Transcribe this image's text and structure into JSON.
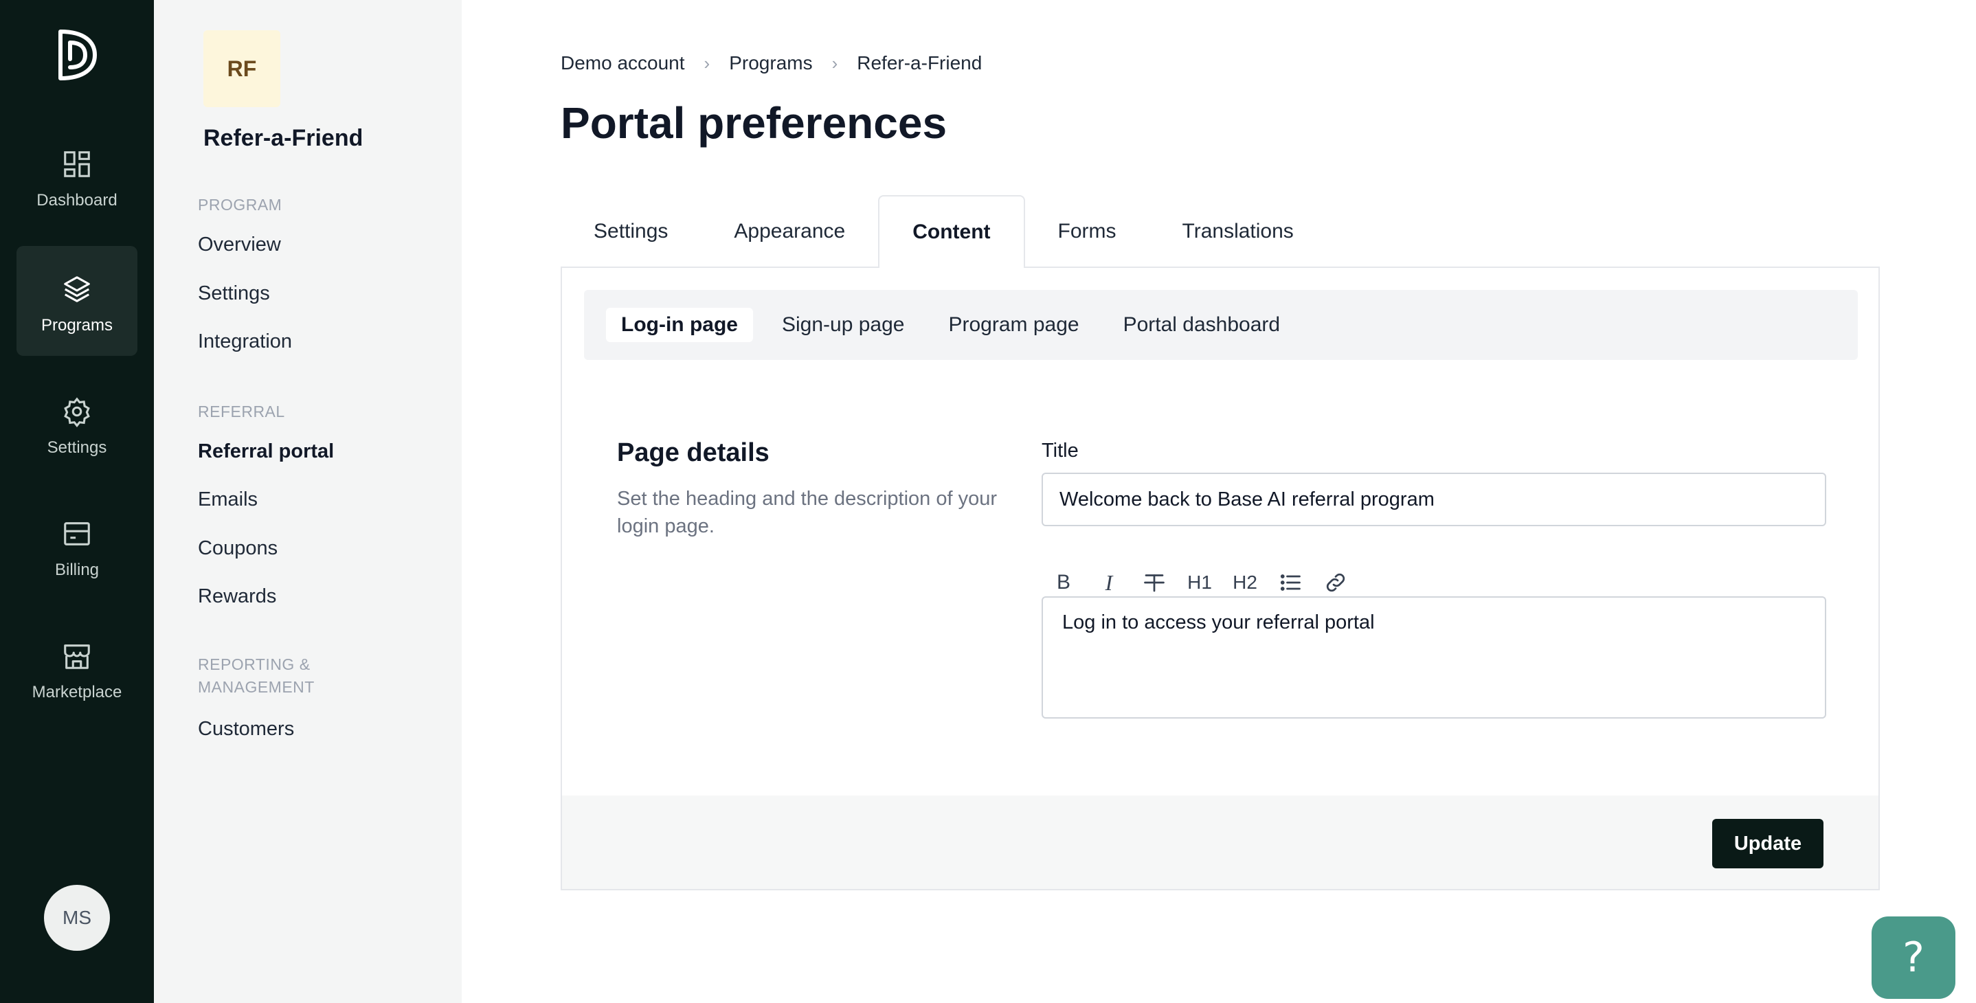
{
  "rail": {
    "items": [
      {
        "label": "Dashboard",
        "icon": "dashboard-icon"
      },
      {
        "label": "Programs",
        "icon": "layers-icon",
        "active": true
      },
      {
        "label": "Settings",
        "icon": "gear-icon"
      },
      {
        "label": "Billing",
        "icon": "billing-icon"
      },
      {
        "label": "Marketplace",
        "icon": "store-icon"
      }
    ],
    "avatar": "MS"
  },
  "subnav": {
    "badge": "RF",
    "program_name": "Refer-a-Friend",
    "sections": [
      {
        "heading": "PROGRAM",
        "items": [
          "Overview",
          "Settings",
          "Integration"
        ]
      },
      {
        "heading": "REFERRAL",
        "items": [
          "Referral portal",
          "Emails",
          "Coupons",
          "Rewards"
        ]
      },
      {
        "heading_lines": [
          "REPORTING &",
          "MANAGEMENT"
        ],
        "items": [
          "Customers"
        ]
      }
    ],
    "current": "Referral portal"
  },
  "breadcrumb": [
    "Demo account",
    "Programs",
    "Refer-a-Friend"
  ],
  "page_title": "Portal preferences",
  "tabs": [
    "Settings",
    "Appearance",
    "Content",
    "Forms",
    "Translations"
  ],
  "active_tab": "Content",
  "subtabs": [
    "Log-in page",
    "Sign-up page",
    "Program page",
    "Portal dashboard"
  ],
  "active_subtab": "Log-in page",
  "section": {
    "title": "Page details",
    "description": "Set the heading and the description of your login page."
  },
  "form": {
    "title_label": "Title",
    "title_value": "Welcome back to Base AI referral program",
    "toolbar": [
      "bold",
      "italic",
      "strikethrough",
      "heading-1",
      "heading-2",
      "bullet-list",
      "link"
    ],
    "toolbar_glyphs": {
      "bold": "B",
      "italic": "I",
      "h1": "H1",
      "h2": "H2"
    },
    "body_value": "Log in to access your referral portal"
  },
  "update_label": "Update",
  "help_label": "?",
  "colors": {
    "rail_bg": "#0a1a17",
    "accent": "#4a9a8a",
    "badge_bg": "#fdf6dc"
  }
}
